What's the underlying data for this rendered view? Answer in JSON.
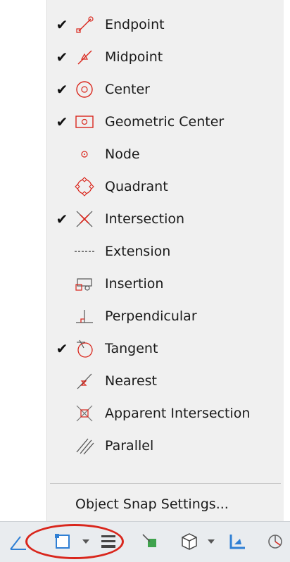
{
  "menu": {
    "items": [
      {
        "label": "Endpoint",
        "checked": true,
        "icon": "endpoint-icon"
      },
      {
        "label": "Midpoint",
        "checked": true,
        "icon": "midpoint-icon"
      },
      {
        "label": "Center",
        "checked": true,
        "icon": "center-icon"
      },
      {
        "label": "Geometric Center",
        "checked": true,
        "icon": "geometric-center-icon"
      },
      {
        "label": "Node",
        "checked": false,
        "icon": "node-icon"
      },
      {
        "label": "Quadrant",
        "checked": false,
        "icon": "quadrant-icon"
      },
      {
        "label": "Intersection",
        "checked": true,
        "icon": "intersection-icon"
      },
      {
        "label": "Extension",
        "checked": false,
        "icon": "extension-icon"
      },
      {
        "label": "Insertion",
        "checked": false,
        "icon": "insertion-icon"
      },
      {
        "label": "Perpendicular",
        "checked": false,
        "icon": "perpendicular-icon"
      },
      {
        "label": "Tangent",
        "checked": true,
        "icon": "tangent-icon"
      },
      {
        "label": "Nearest",
        "checked": false,
        "icon": "nearest-icon"
      },
      {
        "label": "Apparent Intersection",
        "checked": false,
        "icon": "apparent-intersection-icon"
      },
      {
        "label": "Parallel",
        "checked": false,
        "icon": "parallel-icon"
      }
    ],
    "settings_label": "Object Snap Settings...",
    "check_glyph": "✔"
  },
  "colors": {
    "icon_red": "#d9261c",
    "highlight": "#d9261c",
    "toolbar_blue": "#2f7fd4"
  }
}
